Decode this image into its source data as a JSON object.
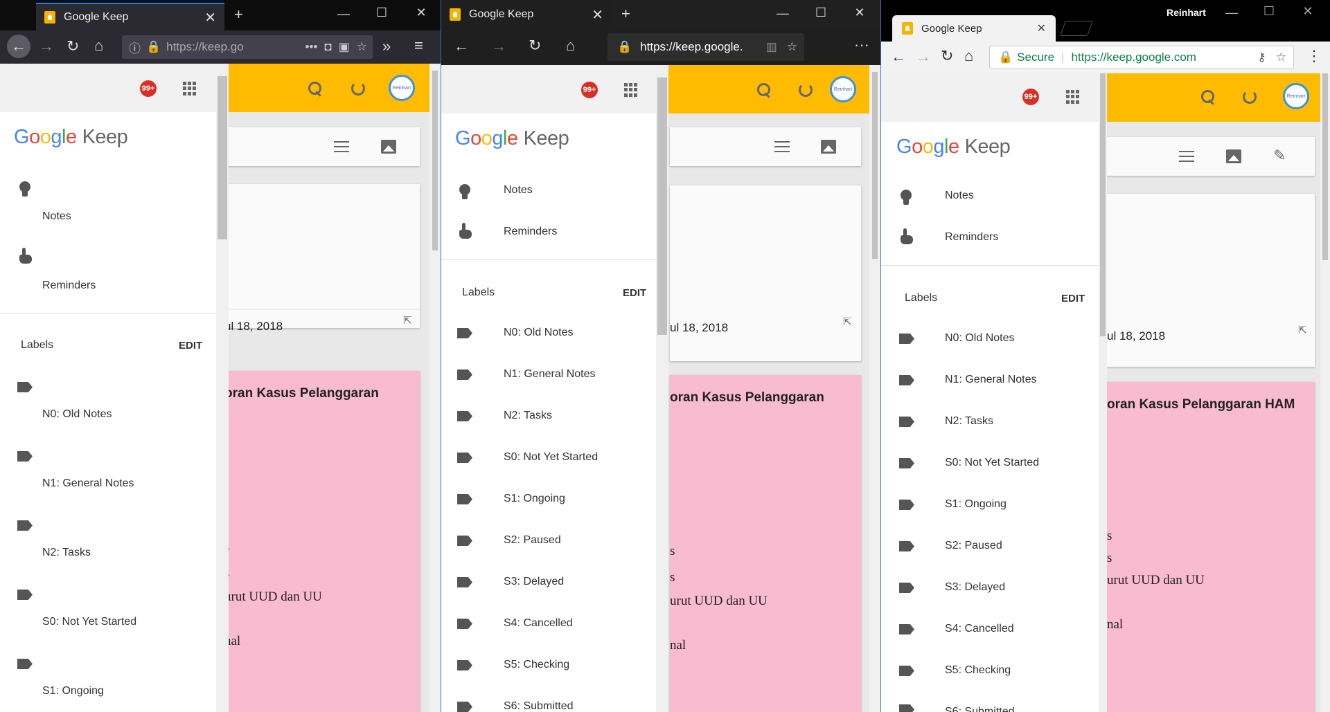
{
  "windows": [
    {
      "browser": "firefox",
      "tab_title": "Google Keep",
      "url_text": "https://keep.go",
      "badge": "99+",
      "logo": {
        "google": "Google",
        "keep": "Keep"
      },
      "nav": [
        "Notes",
        "Reminders"
      ],
      "labels_header": "Labels",
      "edit": "EDIT",
      "labels": [
        "N0: Old Notes",
        "N1: General Notes",
        "N2: Tasks",
        "S0: Not Yet Started",
        "S1: Ongoing"
      ],
      "note_date": "ul 18, 2018",
      "note_title": "oran Kasus Pelanggaran",
      "note_lines": [
        "s",
        "s",
        "urut UUD dan UU",
        "nal"
      ]
    },
    {
      "browser": "edge",
      "tab_title": "Google Keep",
      "url_text": "https://keep.google.",
      "badge": "99+",
      "logo": {
        "google": "Google",
        "keep": "Keep"
      },
      "nav": [
        "Notes",
        "Reminders"
      ],
      "labels_header": "Labels",
      "edit": "EDIT",
      "labels": [
        "N0: Old Notes",
        "N1: General Notes",
        "N2: Tasks",
        "S0: Not Yet Started",
        "S1: Ongoing",
        "S2: Paused",
        "S3: Delayed",
        "S4: Cancelled",
        "S5: Checking",
        "S6: Submitted"
      ],
      "note_date": "ul 18, 2018",
      "note_title": "oran Kasus Pelanggaran",
      "note_lines": [
        "s",
        "s",
        "urut UUD dan UU",
        "nal"
      ]
    },
    {
      "browser": "chrome",
      "tab_title": "Google Keep",
      "user": "Reinhart",
      "secure": "Secure",
      "url_text": "https://keep.google.com",
      "badge": "99+",
      "logo": {
        "google": "Google",
        "keep": "Keep"
      },
      "nav": [
        "Notes",
        "Reminders"
      ],
      "labels_header": "Labels",
      "edit": "EDIT",
      "labels": [
        "N0: Old Notes",
        "N1: General Notes",
        "N2: Tasks",
        "S0: Not Yet Started",
        "S1: Ongoing",
        "S2: Paused",
        "S3: Delayed",
        "S4: Cancelled",
        "S5: Checking",
        "S6: Submitted"
      ],
      "note_date": "ul 18, 2018",
      "note_title": "oran Kasus Pelanggaran HAM",
      "note_lines": [
        "s",
        "s",
        "urut UUD dan UU",
        "nal"
      ]
    }
  ],
  "avatar_text": "Reinhart",
  "colors": {
    "keep_yellow": "#ffbb00",
    "note_pink": "#f8bbd0",
    "badge_red": "#d93025"
  }
}
